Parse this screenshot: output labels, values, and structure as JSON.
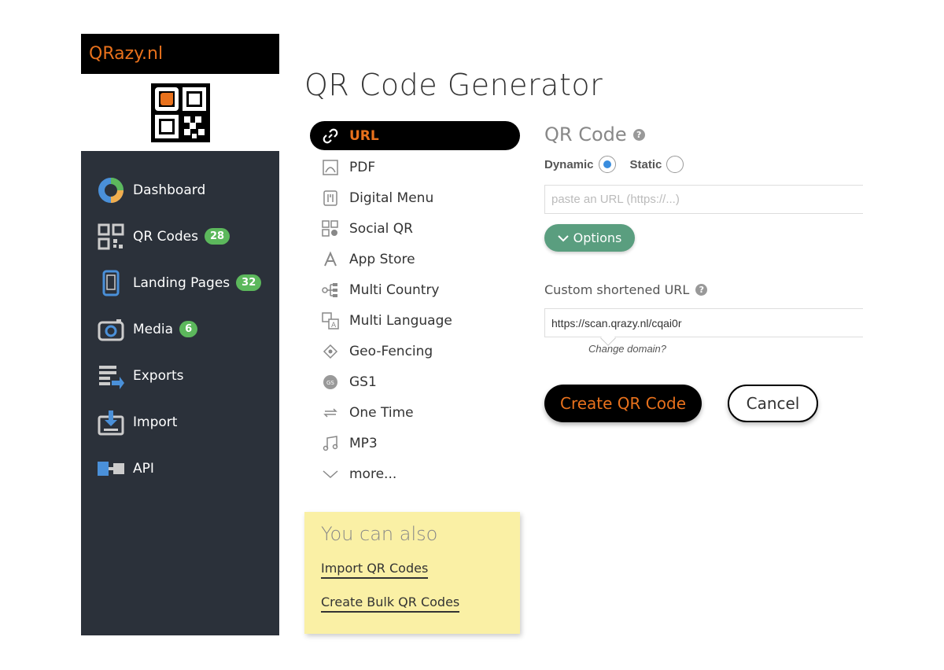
{
  "brand": {
    "name": "QRazy.nl",
    "color": "#e8711c"
  },
  "sidebar": {
    "items": [
      {
        "label": "Dashboard",
        "icon": "dashboard-icon",
        "badge": null
      },
      {
        "label": "QR Codes",
        "icon": "qr-code-icon",
        "badge": "28"
      },
      {
        "label": "Landing Pages",
        "icon": "mobile-icon",
        "badge": "32"
      },
      {
        "label": "Media",
        "icon": "camera-icon",
        "badge": "6"
      },
      {
        "label": "Exports",
        "icon": "export-icon",
        "badge": null
      },
      {
        "label": "Import",
        "icon": "import-icon",
        "badge": null
      },
      {
        "label": "API",
        "icon": "api-icon",
        "badge": null
      }
    ]
  },
  "page": {
    "title": "QR Code Generator"
  },
  "types": [
    {
      "label": "URL",
      "icon": "link-icon",
      "active": true
    },
    {
      "label": "PDF",
      "icon": "pdf-icon"
    },
    {
      "label": "Digital Menu",
      "icon": "menu-icon"
    },
    {
      "label": "Social QR",
      "icon": "social-icon"
    },
    {
      "label": "App Store",
      "icon": "app-store-icon"
    },
    {
      "label": "Multi Country",
      "icon": "multi-country-icon"
    },
    {
      "label": "Multi Language",
      "icon": "language-icon"
    },
    {
      "label": "Geo-Fencing",
      "icon": "geo-icon"
    },
    {
      "label": "GS1",
      "icon": "gs1-icon"
    },
    {
      "label": "One Time",
      "icon": "one-time-icon"
    },
    {
      "label": "MP3",
      "icon": "music-icon"
    },
    {
      "label": "more...",
      "icon": "chevron-down-icon"
    }
  ],
  "note": {
    "title": "You can also",
    "link1": "Import QR Codes",
    "link2": "Create Bulk QR Codes"
  },
  "form": {
    "qr_title": "QR Code",
    "dynamic_label": "Dynamic",
    "static_label": "Static",
    "url_placeholder": "paste an URL (https://...)",
    "options_label": "Options",
    "custom_label": "Custom shortened URL",
    "short_url": "https://scan.qrazy.nl/cqai0r",
    "change_domain": "Change domain?",
    "create_label": "Create QR Code",
    "cancel_label": "Cancel"
  }
}
